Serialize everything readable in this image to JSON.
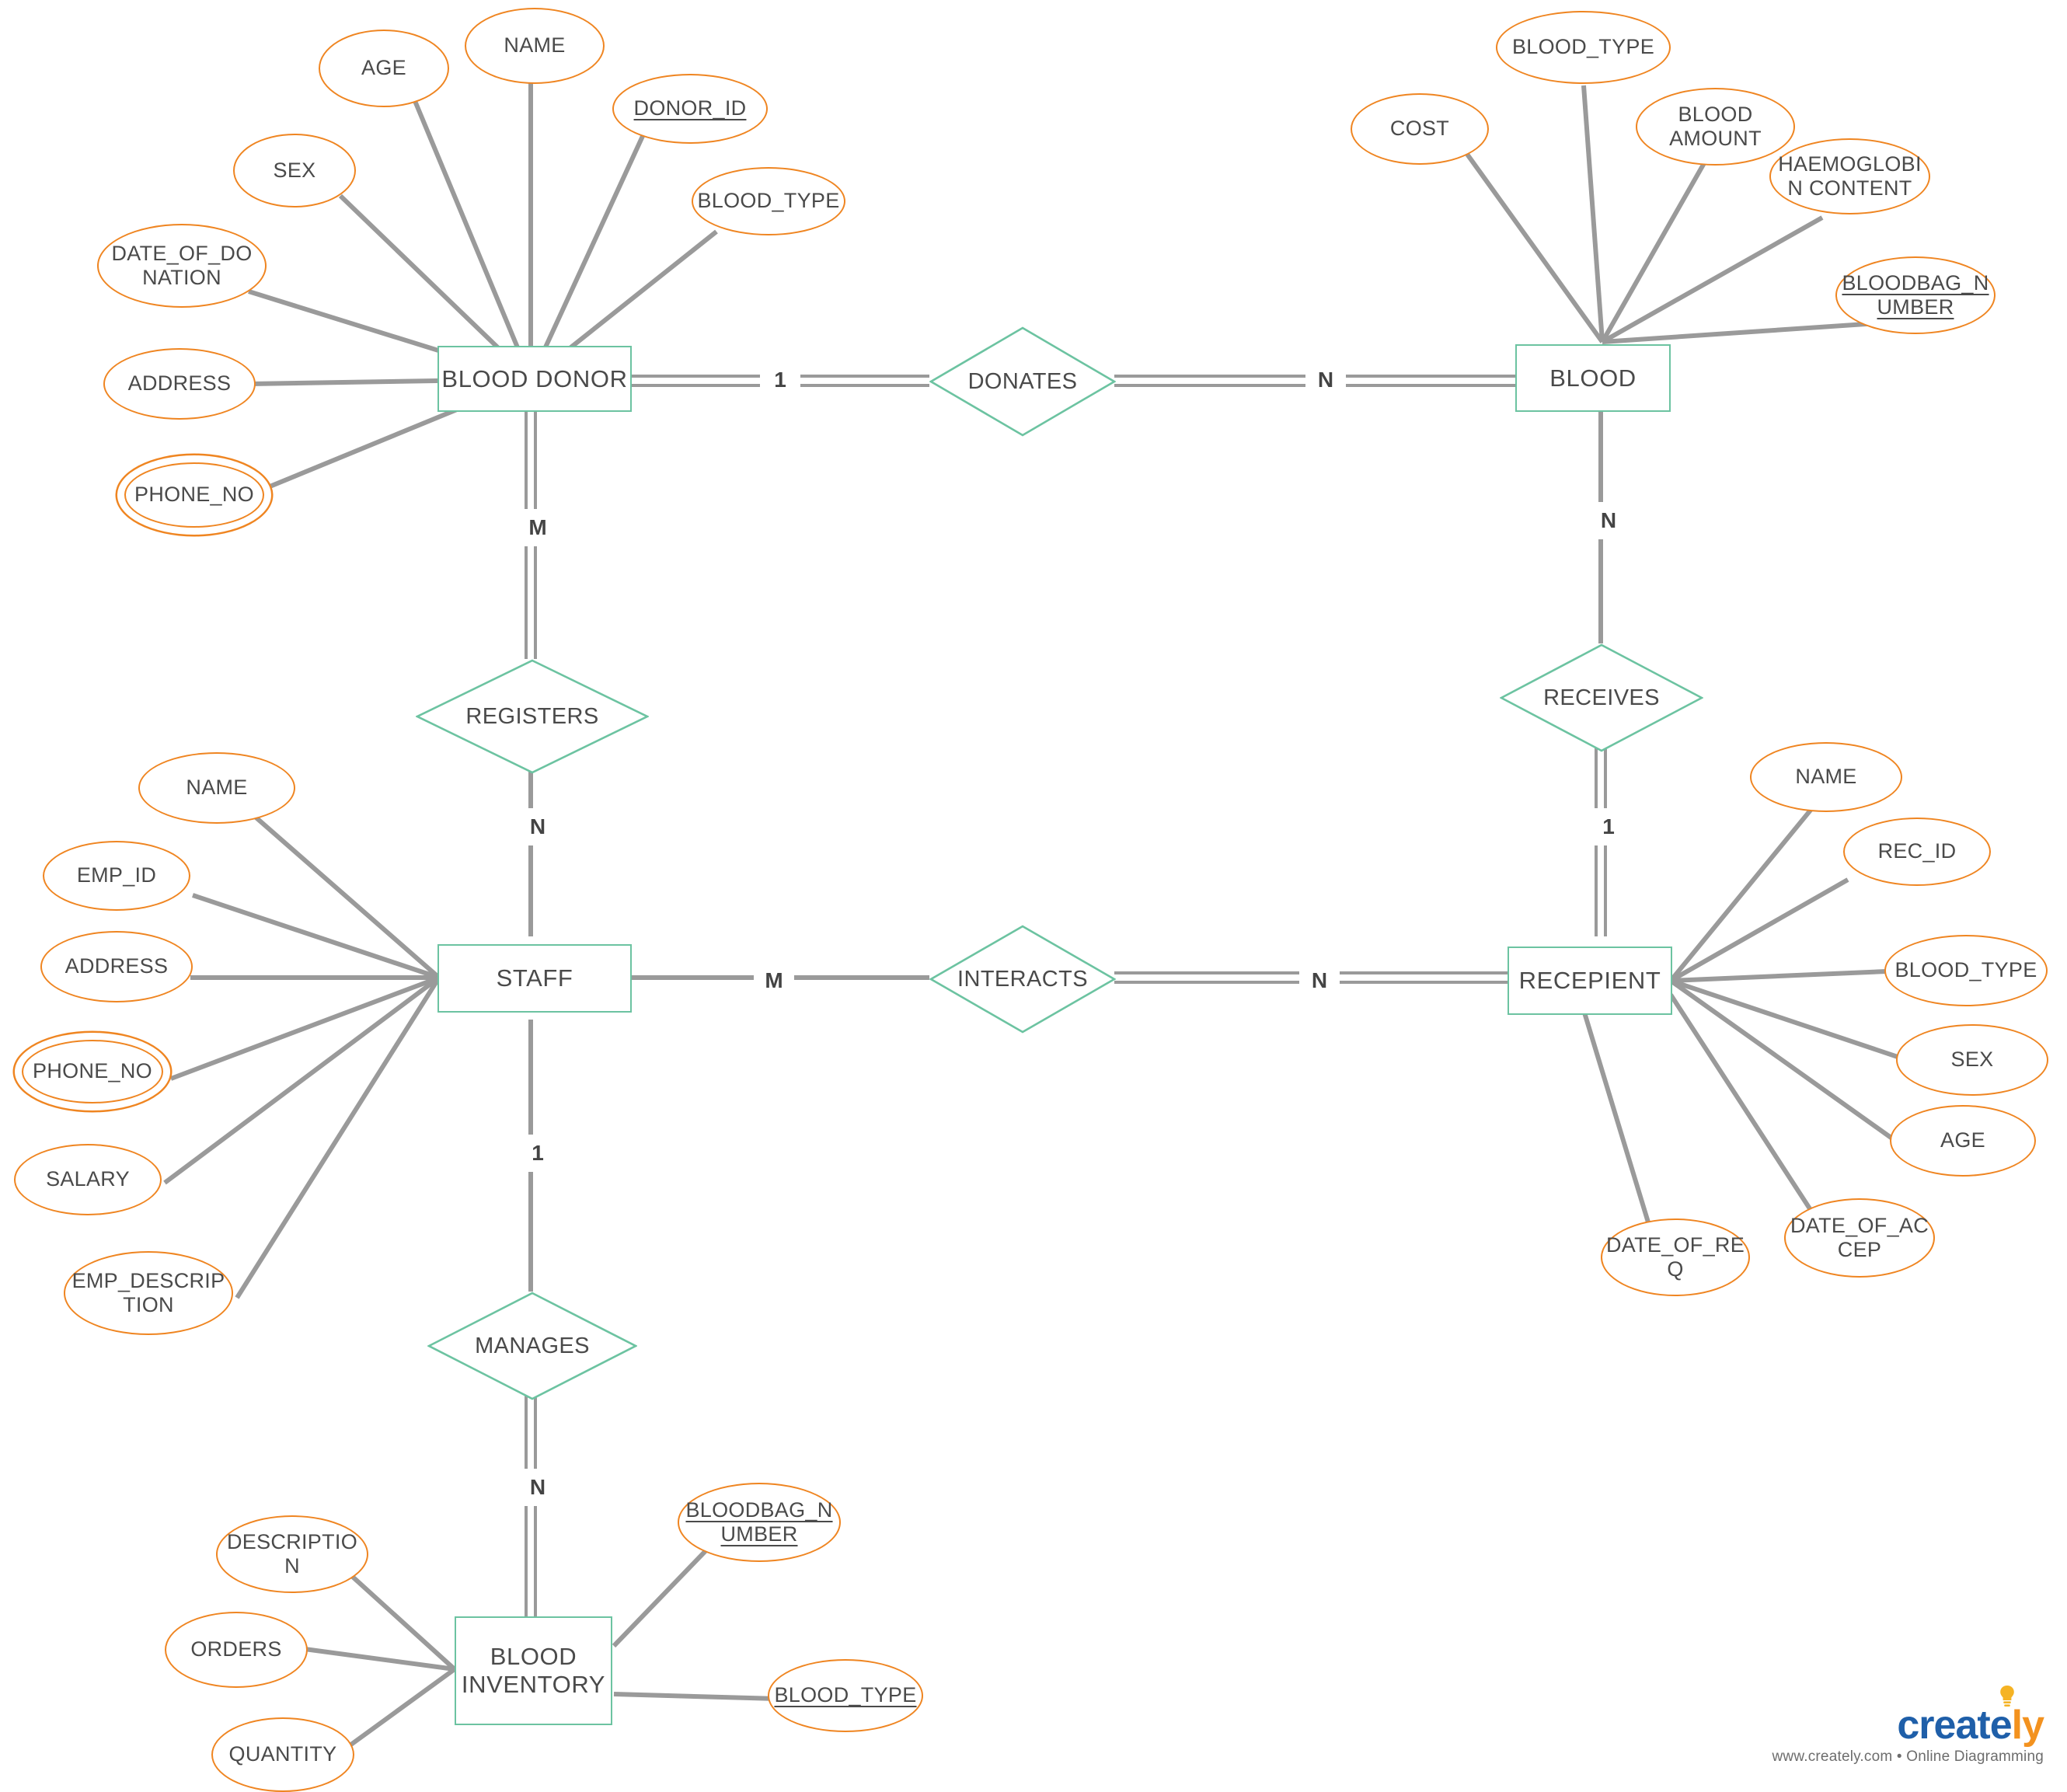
{
  "diagram": {
    "title": "Blood Bank ER Diagram",
    "colors": {
      "entity_border": "#6cc3a1",
      "relationship_border": "#6cc3a1",
      "attribute_border": "#ef8521",
      "connector": "#9a9a9a",
      "text": "#4a4a4a"
    }
  },
  "entities": [
    {
      "id": "blood_donor",
      "label": "BLOOD DONOR"
    },
    {
      "id": "blood",
      "label": "BLOOD"
    },
    {
      "id": "staff",
      "label": "STAFF"
    },
    {
      "id": "recepient",
      "label": "RECEPIENT"
    },
    {
      "id": "blood_inventory",
      "label": "BLOOD\nINVENTORY"
    }
  ],
  "relationships": [
    {
      "id": "donates",
      "label": "DONATES",
      "from": "blood_donor",
      "to": "blood",
      "from_card": "1",
      "to_card": "N"
    },
    {
      "id": "registers",
      "label": "REGISTERS",
      "from": "blood_donor",
      "to": "staff",
      "from_card": "M",
      "to_card": "N"
    },
    {
      "id": "receives",
      "label": "RECEIVES",
      "from": "blood",
      "to": "recepient",
      "from_card": "N",
      "to_card": "1"
    },
    {
      "id": "interacts",
      "label": "INTERACTS",
      "from": "staff",
      "to": "recepient",
      "from_card": "M",
      "to_card": "N"
    },
    {
      "id": "manages",
      "label": "MANAGES",
      "from": "staff",
      "to": "blood_inventory",
      "from_card": "1",
      "to_card": "N"
    }
  ],
  "attributes": {
    "blood_donor": [
      {
        "label": "AGE",
        "key": false,
        "multivalued": false
      },
      {
        "label": "NAME",
        "key": false,
        "multivalued": false
      },
      {
        "label": "DONOR_ID",
        "key": true,
        "multivalued": false
      },
      {
        "label": "BLOOD_TYPE",
        "key": false,
        "multivalued": false
      },
      {
        "label": "SEX",
        "key": false,
        "multivalued": false
      },
      {
        "label": "DATE_OF_DO\nNATION",
        "key": false,
        "multivalued": false
      },
      {
        "label": "ADDRESS",
        "key": false,
        "multivalued": false
      },
      {
        "label": "PHONE_NO",
        "key": false,
        "multivalued": true
      }
    ],
    "blood": [
      {
        "label": "BLOOD_TYPE",
        "key": false,
        "multivalued": false
      },
      {
        "label": "COST",
        "key": false,
        "multivalued": false
      },
      {
        "label": "BLOOD\nAMOUNT",
        "key": false,
        "multivalued": false
      },
      {
        "label": "HAEMOGLOBI\nN CONTENT",
        "key": false,
        "multivalued": false
      },
      {
        "label": "BLOODBAG_N\nUMBER",
        "key": true,
        "multivalued": false
      }
    ],
    "staff": [
      {
        "label": "NAME",
        "key": false,
        "multivalued": false
      },
      {
        "label": "EMP_ID",
        "key": false,
        "multivalued": false
      },
      {
        "label": "ADDRESS",
        "key": false,
        "multivalued": false
      },
      {
        "label": "PHONE_NO",
        "key": false,
        "multivalued": true
      },
      {
        "label": "SALARY",
        "key": false,
        "multivalued": false
      },
      {
        "label": "EMP_DESCRIP\nTION",
        "key": false,
        "multivalued": false
      }
    ],
    "recepient": [
      {
        "label": "NAME",
        "key": false,
        "multivalued": false
      },
      {
        "label": "REC_ID",
        "key": false,
        "multivalued": false
      },
      {
        "label": "BLOOD_TYPE",
        "key": false,
        "multivalued": false
      },
      {
        "label": "SEX",
        "key": false,
        "multivalued": false
      },
      {
        "label": "AGE",
        "key": false,
        "multivalued": false
      },
      {
        "label": "DATE_OF_RE\nQ",
        "key": false,
        "multivalued": false
      },
      {
        "label": "DATE_OF_AC\nCEP",
        "key": false,
        "multivalued": false
      }
    ],
    "blood_inventory": [
      {
        "label": "DESCRIPTIO\nN",
        "key": false,
        "multivalued": false
      },
      {
        "label": "ORDERS",
        "key": false,
        "multivalued": false
      },
      {
        "label": "QUANTITY",
        "key": false,
        "multivalued": false
      },
      {
        "label": "BLOODBAG_N\nUMBER",
        "key": true,
        "multivalued": false
      },
      {
        "label": "BLOOD_TYPE",
        "key": true,
        "multivalued": false
      }
    ]
  },
  "cardinality_markers": [
    {
      "id": "donates_left",
      "value": "1"
    },
    {
      "id": "donates_right",
      "value": "N"
    },
    {
      "id": "registers_top",
      "value": "M"
    },
    {
      "id": "registers_bot",
      "value": "N"
    },
    {
      "id": "receives_top",
      "value": "N"
    },
    {
      "id": "receives_bot",
      "value": "1"
    },
    {
      "id": "interacts_left",
      "value": "M"
    },
    {
      "id": "interacts_right",
      "value": "N"
    },
    {
      "id": "manages_top",
      "value": "1"
    },
    {
      "id": "manages_bot",
      "value": "N"
    }
  ],
  "watermark": {
    "logo_part1": "creat",
    "logo_part2": "e",
    "logo_part3": "ly",
    "tagline": "www.creately.com • Online Diagramming"
  }
}
